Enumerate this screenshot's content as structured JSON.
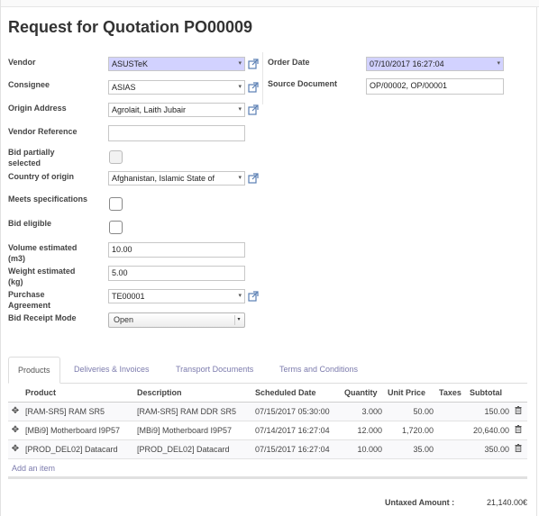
{
  "form": {
    "title": "Request for Quotation PO00009",
    "left_fields": {
      "vendor": {
        "label": "Vendor",
        "value": "ASUSTeK"
      },
      "consignee": {
        "label": "Consignee",
        "value": "ASIAS"
      },
      "origin_address": {
        "label": "Origin Address",
        "value": "Agrolait, Laith Jubair"
      },
      "vendor_reference": {
        "label": "Vendor Reference",
        "value": ""
      },
      "bid_partially": {
        "label_line1": "Bid partially",
        "label_line2": "selected",
        "checked": false
      },
      "country_origin": {
        "label": "Country of origin",
        "value": "Afghanistan, Islamic State of"
      },
      "meets_spec": {
        "label": "Meets specifications",
        "checked": false
      },
      "bid_eligible": {
        "label": "Bid eligible",
        "checked": false
      },
      "volume": {
        "label_line1": "Volume estimated",
        "label_line2": "(m3)",
        "value": "10.00"
      },
      "weight": {
        "label_line1": "Weight estimated",
        "label_line2": "(kg)",
        "value": "5.00"
      },
      "purchase_agreement": {
        "label_line1": "Purchase",
        "label_line2": "Agreement",
        "value": "TE00001"
      },
      "bid_receipt_mode": {
        "label": "Bid Receipt Mode",
        "value": "Open"
      }
    },
    "right_fields": {
      "order_date": {
        "label": "Order Date",
        "value": "07/10/2017 16:27:04"
      },
      "source_document": {
        "label": "Source Document",
        "value": "OP/00002, OP/00001"
      }
    }
  },
  "tabs": [
    {
      "label": "Products",
      "active": true
    },
    {
      "label": "Deliveries & Invoices",
      "active": false
    },
    {
      "label": "Transport Documents",
      "active": false
    },
    {
      "label": "Terms and Conditions",
      "active": false
    }
  ],
  "lines": {
    "headers": {
      "product": "Product",
      "description": "Description",
      "scheduled_date": "Scheduled Date",
      "quantity": "Quantity",
      "unit_price": "Unit Price",
      "taxes": "Taxes",
      "subtotal": "Subtotal"
    },
    "rows": [
      {
        "product": "[RAM-SR5] RAM SR5",
        "description": "[RAM-SR5] RAM DDR SR5",
        "scheduled_date": "07/15/2017 05:30:00",
        "quantity": "3.000",
        "unit_price": "50.00",
        "taxes": "",
        "subtotal": "150.00"
      },
      {
        "product": "[MBi9] Motherboard I9P57",
        "description": "[MBi9] Motherboard I9P57",
        "scheduled_date": "07/14/2017 16:27:04",
        "quantity": "12.000",
        "unit_price": "1,720.00",
        "taxes": "",
        "subtotal": "20,640.00"
      },
      {
        "product": "[PROD_DEL02] Datacard",
        "description": "[PROD_DEL02] Datacard",
        "scheduled_date": "07/15/2017 16:27:04",
        "quantity": "10.000",
        "unit_price": "35.00",
        "taxes": "",
        "subtotal": "350.00"
      }
    ],
    "add_item": "Add an item"
  },
  "totals": {
    "untaxed_label": "Untaxed Amount :",
    "untaxed_value": "21,140.00€"
  },
  "colors": {
    "required_bg": "#d2d2ff",
    "link": "#7c7bad"
  }
}
